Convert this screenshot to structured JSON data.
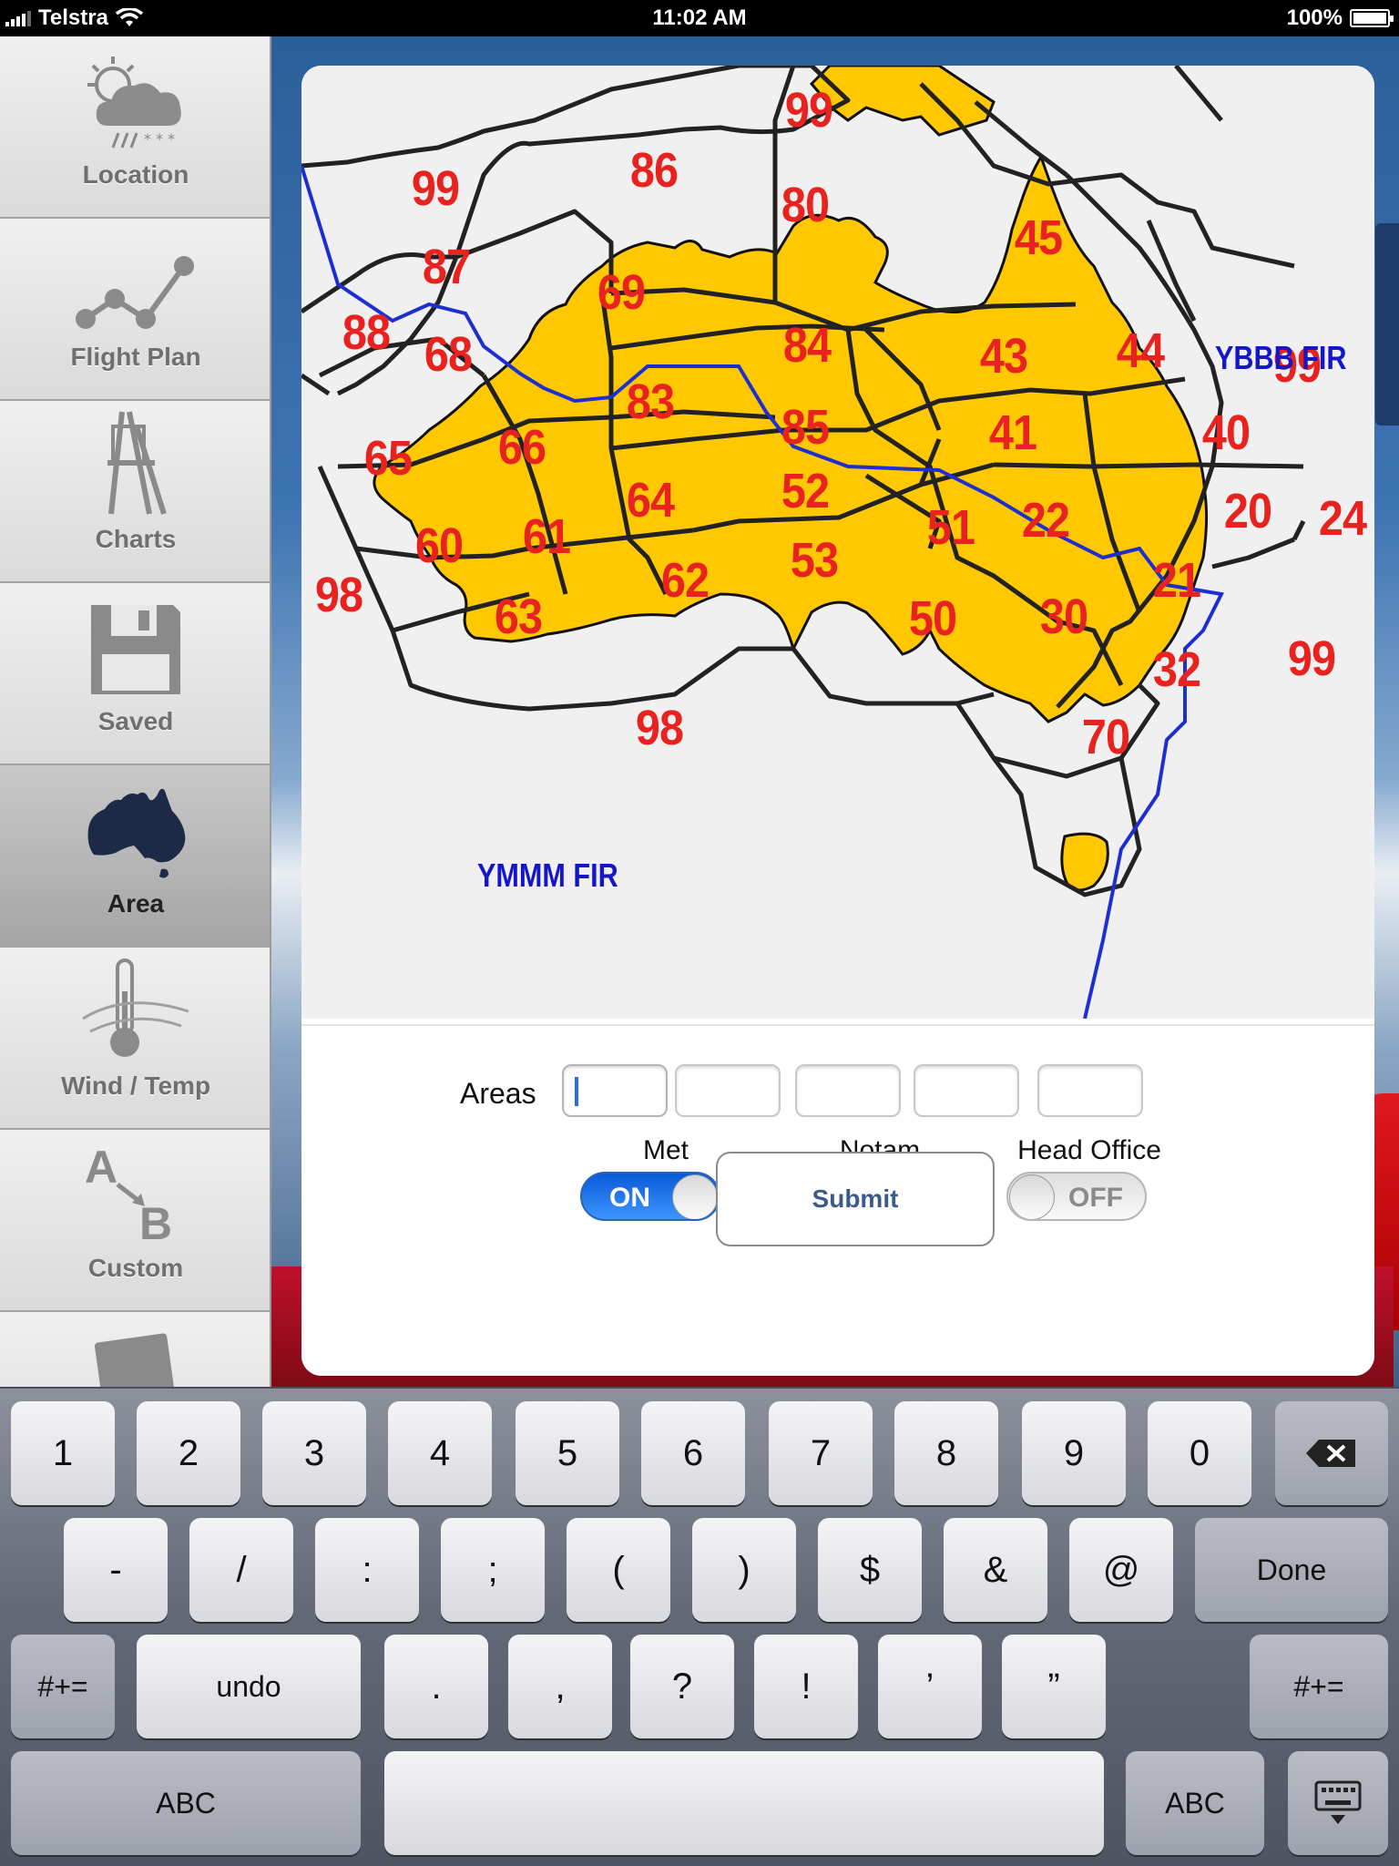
{
  "status_bar": {
    "carrier": "Telstra",
    "time": "11:02 AM",
    "battery": "100%",
    "battery_level": 1.0
  },
  "sidebar": {
    "items": [
      {
        "label": "Location",
        "icon": "weather-cloud-icon",
        "active": false
      },
      {
        "label": "Flight Plan",
        "icon": "flight-plan-graph-icon",
        "active": false
      },
      {
        "label": "Charts",
        "icon": "easel-icon",
        "active": false
      },
      {
        "label": "Saved",
        "icon": "floppy-disk-icon",
        "active": false
      },
      {
        "label": "Area",
        "icon": "australia-map-icon",
        "active": true
      },
      {
        "label": "Wind / Temp",
        "icon": "thermometer-wind-icon",
        "active": false
      },
      {
        "label": "Custom",
        "icon": "a-to-b-icon",
        "active": false
      },
      {
        "label": "",
        "icon": "notebook-icon",
        "active": false
      }
    ]
  },
  "map": {
    "area_numbers": [
      "99",
      "86",
      "80",
      "45",
      "99",
      "87",
      "69",
      "88",
      "68",
      "84",
      "43",
      "44",
      "99",
      "83",
      "85",
      "41",
      "40",
      "66",
      "65",
      "64",
      "52",
      "20",
      "51",
      "22",
      "24",
      "60",
      "61",
      "53",
      "62",
      "21",
      "98",
      "63",
      "50",
      "30",
      "32",
      "99",
      "70",
      "98"
    ],
    "fir_labels": {
      "ybbb": "YBBB FIR",
      "ymmm": "YMMM FIR"
    },
    "colors": {
      "land": "#ffc800",
      "sea": "#f0f0f0",
      "area_number": "#e8231f",
      "fir": "#1416c8",
      "boundary": "#222222"
    }
  },
  "form": {
    "areas_label": "Areas",
    "areas_values": [
      "",
      "",
      "",
      "",
      ""
    ],
    "toggles": [
      {
        "label": "Met",
        "state": "ON"
      },
      {
        "label": "Notam",
        "state": "ON"
      },
      {
        "label": "Head Office",
        "state": "OFF"
      }
    ],
    "submit_label": "Submit"
  },
  "keyboard": {
    "row1": [
      "1",
      "2",
      "3",
      "4",
      "5",
      "6",
      "7",
      "8",
      "9",
      "0"
    ],
    "row1_delete": "delete-icon",
    "row2": [
      "-",
      "/",
      ":",
      ";",
      "(",
      ")",
      "$",
      "&",
      "@"
    ],
    "row2_done": "Done",
    "row3_left": "#+=",
    "row3_undo": "undo",
    "row3": [
      ".",
      ",",
      "?",
      "!",
      "’",
      "”"
    ],
    "row3_right": "#+=",
    "row4_left": "ABC",
    "row4_right": "ABC",
    "row4_hide": "keyboard-dismiss-icon"
  }
}
